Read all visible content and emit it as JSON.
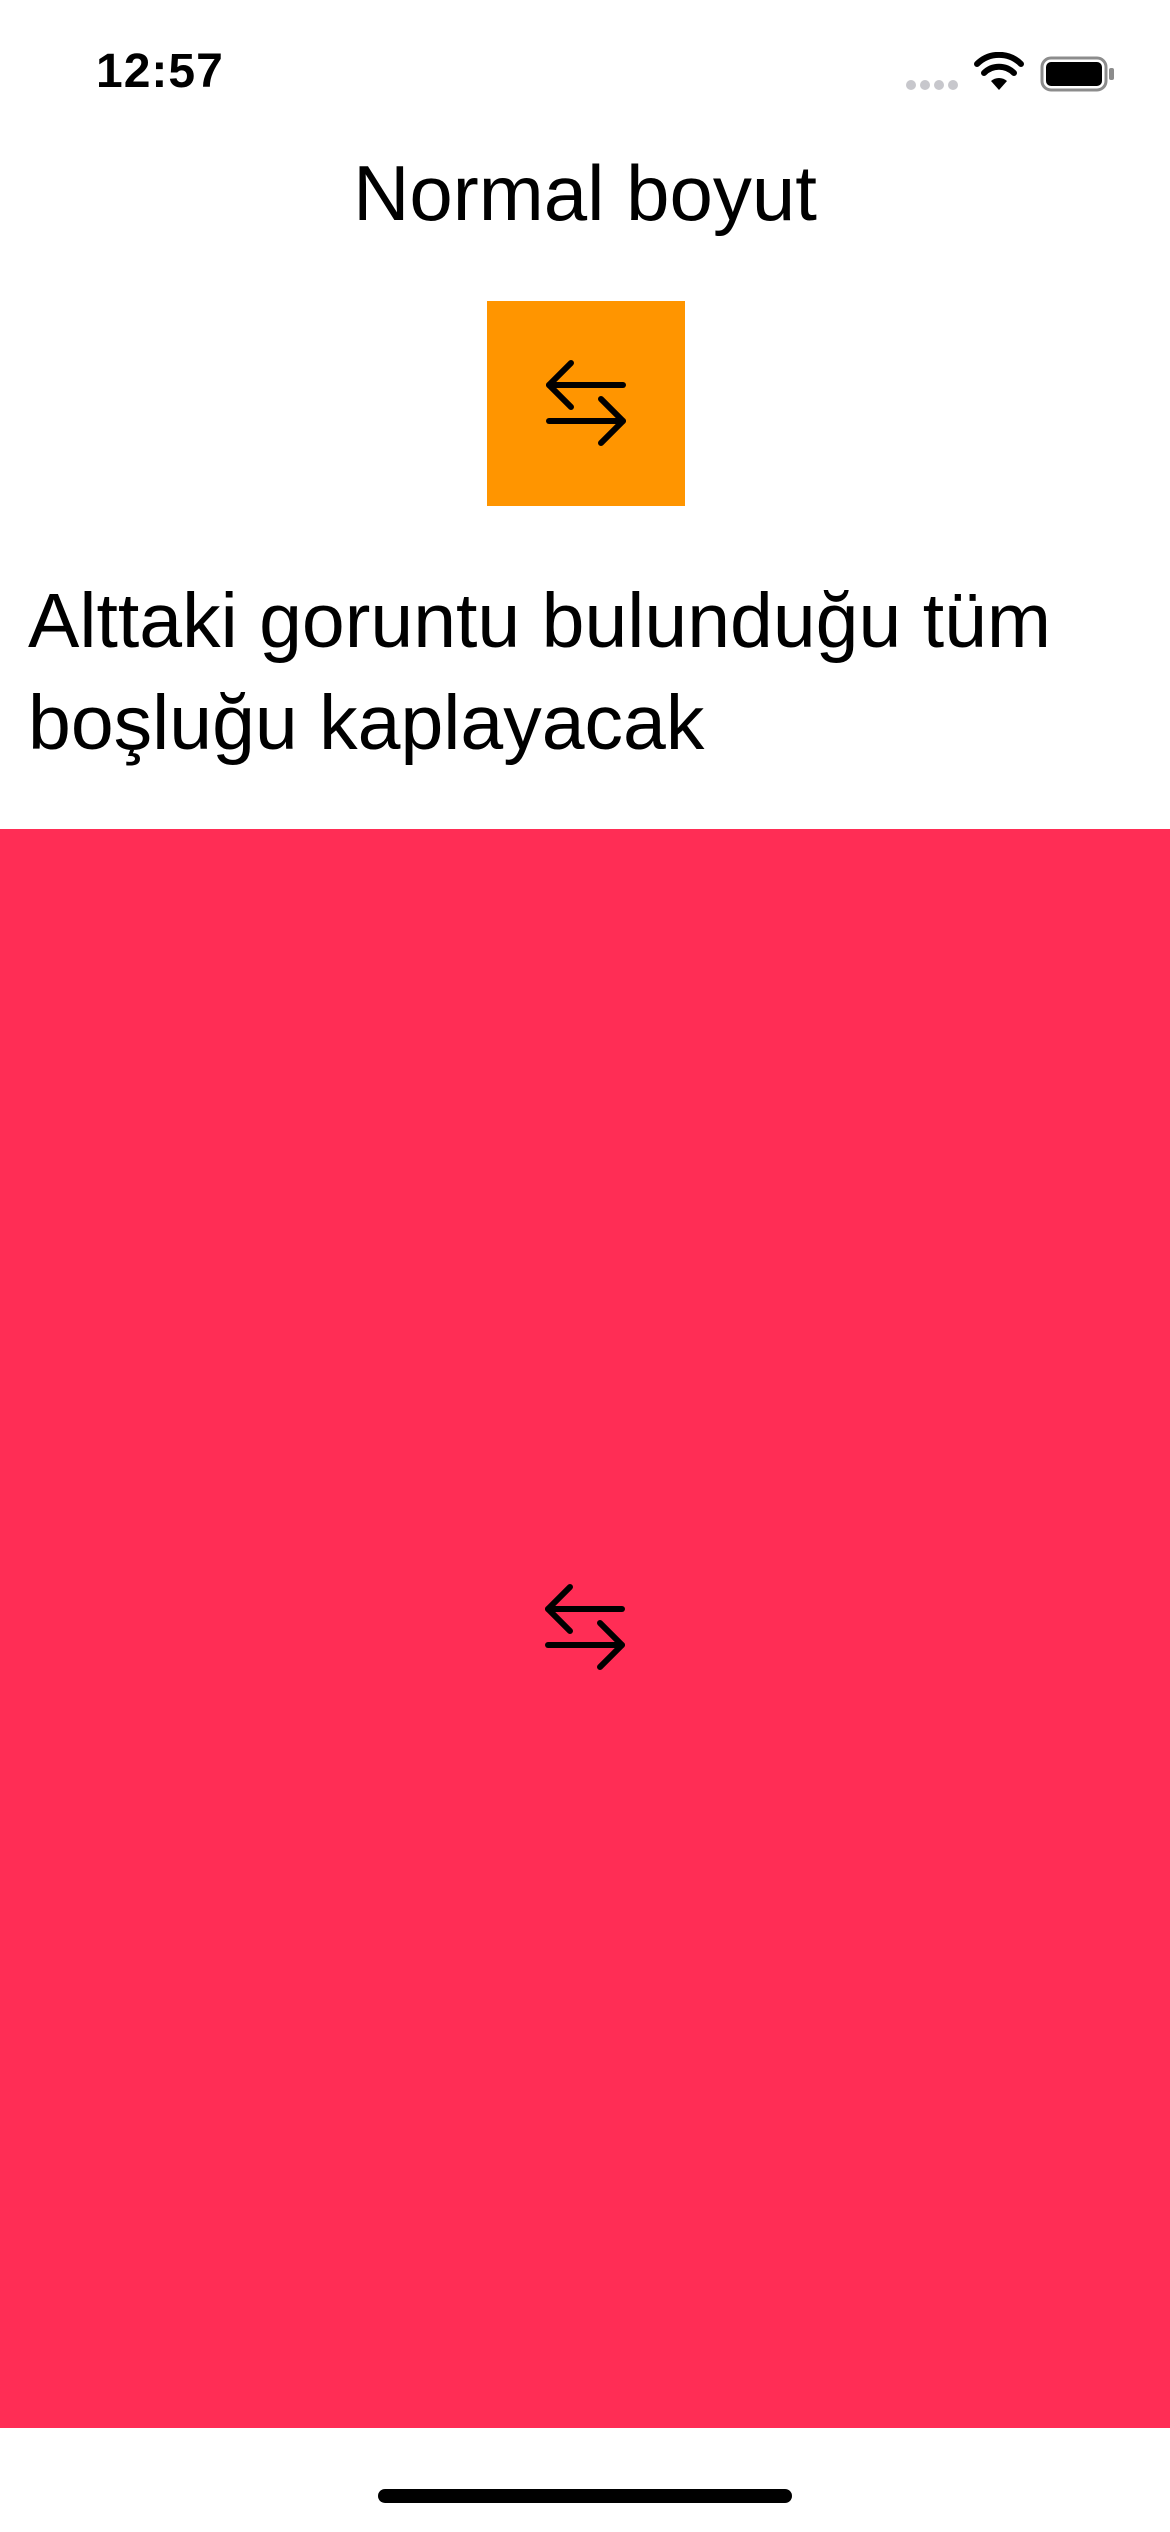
{
  "status_bar": {
    "time": "12:57",
    "signal_icon": "cellular-signal-dots-icon",
    "wifi_icon": "wifi-icon",
    "battery_icon": "battery-full-icon"
  },
  "content": {
    "title": "Normal boyut",
    "small_image": {
      "icon": "arrow-left-right-icon",
      "background_color": "#ff9500"
    },
    "description": "Alttaki goruntu bulunduğu tüm boşluğu kaplayacak",
    "fill_image": {
      "icon": "arrow-left-right-icon",
      "background_color": "#ff2d55"
    }
  }
}
